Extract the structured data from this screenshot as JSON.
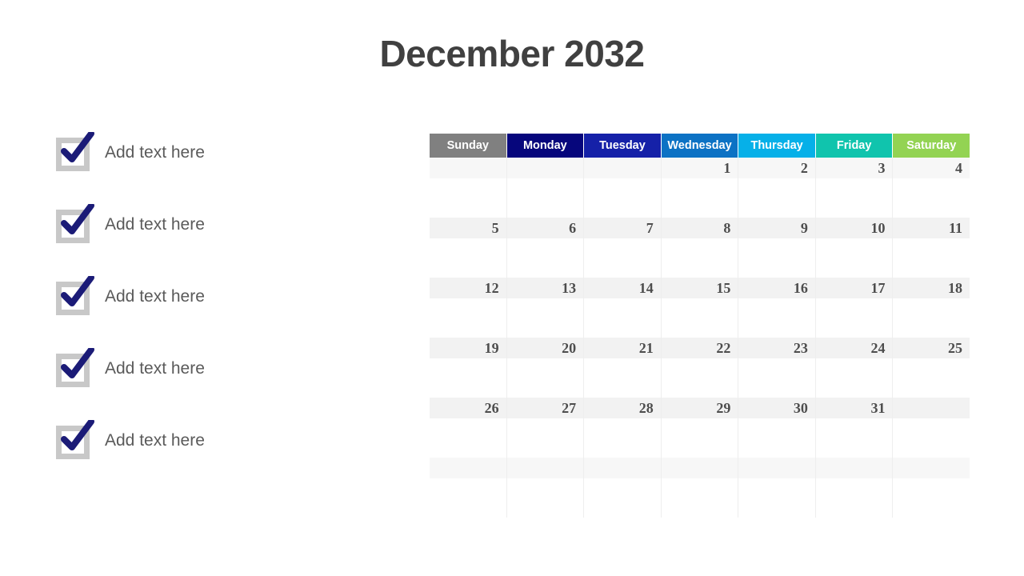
{
  "title": "December 2032",
  "checklist": {
    "items": [
      {
        "label": "Add text here",
        "checked": true
      },
      {
        "label": "Add text here",
        "checked": true
      },
      {
        "label": "Add text here",
        "checked": true
      },
      {
        "label": "Add text here",
        "checked": true
      },
      {
        "label": "Add text here",
        "checked": true
      }
    ],
    "checkbox_frame_color": "#c8c8c8",
    "checkmark_color": "#1b1b77"
  },
  "calendar": {
    "month": "December",
    "year": "2032",
    "day_headers": [
      {
        "label": "Sunday",
        "bg": "#808080"
      },
      {
        "label": "Monday",
        "bg": "#06067c"
      },
      {
        "label": "Tuesday",
        "bg": "#1521a8"
      },
      {
        "label": "Wednesday",
        "bg": "#0c72c4"
      },
      {
        "label": "Thursday",
        "bg": "#06b0e8"
      },
      {
        "label": "Friday",
        "bg": "#10c4ad"
      },
      {
        "label": "Saturday",
        "bg": "#93d353"
      }
    ],
    "weeks": [
      [
        "",
        "",
        "",
        "1",
        "2",
        "3",
        "4"
      ],
      [
        "5",
        "6",
        "7",
        "8",
        "9",
        "10",
        "11"
      ],
      [
        "12",
        "13",
        "14",
        "15",
        "16",
        "17",
        "18"
      ],
      [
        "19",
        "20",
        "21",
        "22",
        "23",
        "24",
        "25"
      ],
      [
        "26",
        "27",
        "28",
        "29",
        "30",
        "31",
        ""
      ],
      [
        "",
        "",
        "",
        "",
        "",
        "",
        ""
      ]
    ],
    "number_band_color": "#f2f2f2",
    "cell_body_color": "#ffffff",
    "grid_line_color": "#eeeeee"
  },
  "colors": {
    "title_text": "#404040",
    "label_text": "#5a5a5a",
    "date_text": "#4d4d4d",
    "page_background": "#ffffff"
  }
}
